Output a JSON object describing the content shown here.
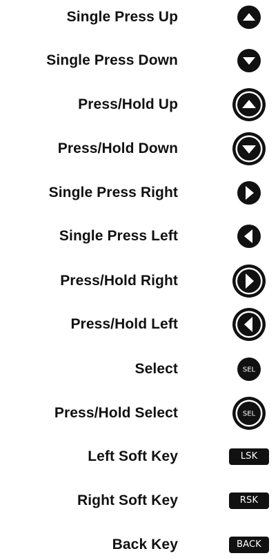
{
  "legend": {
    "items": [
      {
        "label": "Single Press Up"
      },
      {
        "label": "Single Press Down"
      },
      {
        "label": "Press/Hold Up"
      },
      {
        "label": "Press/Hold Down"
      },
      {
        "label": "Single Press Right"
      },
      {
        "label": "Single Press Left"
      },
      {
        "label": "Press/Hold Right"
      },
      {
        "label": "Press/Hold Left"
      },
      {
        "label": "Select",
        "icon_text": "SEL"
      },
      {
        "label": "Press/Hold Select",
        "icon_text": "SEL"
      },
      {
        "label": "Left Soft Key",
        "icon_text": "LSK"
      },
      {
        "label": "Right Soft Key",
        "icon_text": "RSK"
      },
      {
        "label": "Back Key",
        "icon_text": "BACK"
      }
    ]
  },
  "colors": {
    "ink": "#111111",
    "background": "#ffffff"
  },
  "icons": [
    "arrow-up-icon",
    "arrow-down-icon",
    "hold-up-icon",
    "hold-down-icon",
    "arrow-right-icon",
    "arrow-left-icon",
    "hold-right-icon",
    "hold-left-icon",
    "select-icon",
    "hold-select-icon",
    "lsk-key-icon",
    "rsk-key-icon",
    "back-key-icon"
  ]
}
